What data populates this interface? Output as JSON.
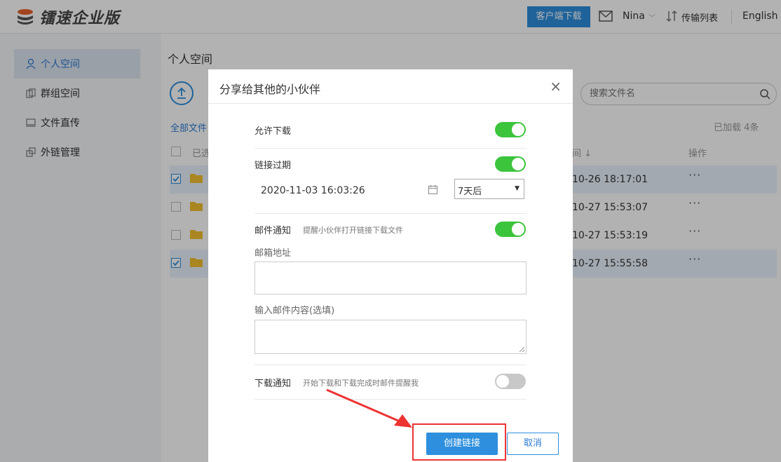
{
  "header": {
    "brand": "镭速企业版",
    "client_download": "客户端下载",
    "user_name": "Nina",
    "transfer_list": "传输列表",
    "language": "English"
  },
  "sidebar": {
    "items": [
      {
        "label": "个人空间",
        "icon": "person-icon",
        "active": true
      },
      {
        "label": "群组空间",
        "icon": "group-space-icon",
        "active": false
      },
      {
        "label": "文件直传",
        "icon": "direct-transfer-icon",
        "active": false
      },
      {
        "label": "外链管理",
        "icon": "link-manage-icon",
        "active": false
      }
    ]
  },
  "main": {
    "title": "个人空间",
    "search_placeholder": "搜索文件名",
    "breadcrumb": "全部文件",
    "loaded_count": "已加载 4条",
    "columns": {
      "selected": "已选",
      "time": "间 ↓",
      "ops": "操作"
    },
    "rows": [
      {
        "time": "10-26 18:17:01",
        "checked": true
      },
      {
        "time": "10-27 15:53:07",
        "checked": false
      },
      {
        "time": "10-27 15:53:19",
        "checked": false
      },
      {
        "time": "10-27 15:55:58",
        "checked": true
      }
    ],
    "more_glyph": "···"
  },
  "modal": {
    "title": "分享给其他的小伙伴",
    "close_glyph": "×",
    "allow_download": {
      "label": "允许下载",
      "on": true
    },
    "link_expiry": {
      "label": "链接过期",
      "on": true,
      "datetime": "2020-11-03 16:03:26",
      "duration": "7天后"
    },
    "email_notify": {
      "label": "邮件通知",
      "hint": "提醒小伙伴打开链接下载文件",
      "on": true
    },
    "email_address": {
      "label": "邮箱地址",
      "value": ""
    },
    "email_content": {
      "label": "输入邮件内容(选填)",
      "value": ""
    },
    "download_notify": {
      "label": "下载通知",
      "hint": "开始下载和下载完成时邮件提醒我",
      "on": false
    },
    "create_button": "创建链接",
    "cancel_button": "取消"
  },
  "colors": {
    "accent": "#2d8fdd",
    "toggle_on": "#3cc43c",
    "toggle_off": "#c8c8c8",
    "highlight": "#e33333"
  }
}
